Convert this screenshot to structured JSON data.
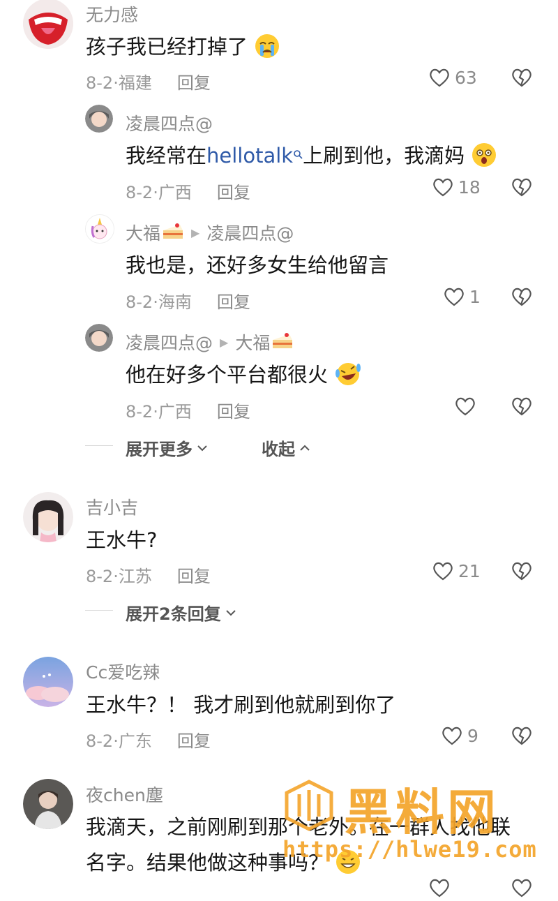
{
  "comments": [
    {
      "user": "无力感",
      "text": "孩子我已经打掉了",
      "date": "8-2·福建",
      "reply": "回复",
      "likes": "63"
    },
    {
      "user": "吉小吉",
      "text": "王水牛?",
      "date": "8-2·江苏",
      "reply": "回复",
      "likes": "21"
    },
    {
      "user": "Cc爱吃辣",
      "text": "王水牛？！ 我才刷到他就刷到你了",
      "date": "8-2·广东",
      "reply": "回复",
      "likes": "9"
    },
    {
      "user": "夜chen塵",
      "text_line1": "我滴天，之前刚刷到那个老外。在一群人找他联",
      "text_line2": "名字。结果他做这种事吗？"
    }
  ],
  "replies": [
    {
      "user": "凌晨四点@",
      "text_pre": "我经常在",
      "link": "hellotalk",
      "text_post": "上刷到他，我滴妈",
      "date": "8-2·广西",
      "reply": "回复",
      "likes": "18"
    },
    {
      "user": "大福",
      "to": "凌晨四点@",
      "text": "我也是，还好多女生给他留言",
      "date": "8-2·海南",
      "reply": "回复",
      "likes": "1"
    },
    {
      "user": "凌晨四点@",
      "to": "大福",
      "text": "他在好多个平台都很火",
      "date": "8-2·广西",
      "reply": "回复",
      "likes": ""
    }
  ],
  "thread_controls": {
    "expand_more": "展开更多",
    "collapse": "收起"
  },
  "expand_replies": "展开2条回复",
  "watermark": {
    "brand": "黑料网",
    "url": "https://hlwe19.com"
  },
  "colors": {
    "accent_link": "#2f5aa8",
    "watermark": "#f4a42a"
  }
}
